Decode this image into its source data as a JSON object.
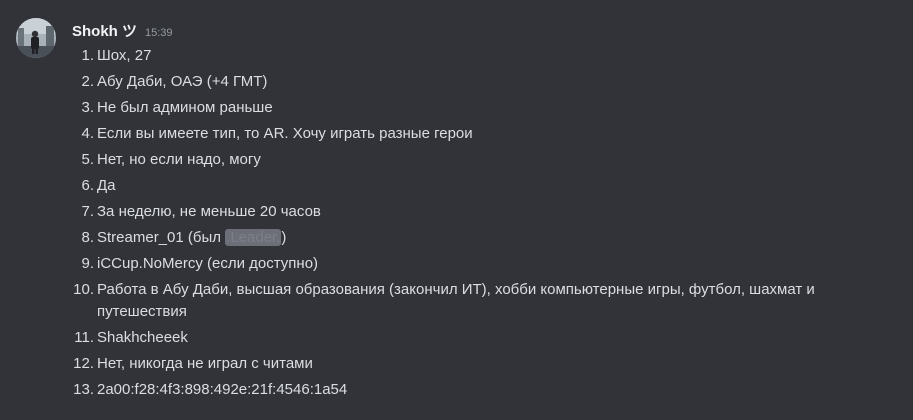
{
  "author": {
    "name": "Shokh ツ",
    "timestamp": "15:39"
  },
  "answers": [
    {
      "num": "1.",
      "text": "Шох, 27"
    },
    {
      "num": "2.",
      "text": "Абу Даби, ОАЭ (+4 ГМТ)"
    },
    {
      "num": "3.",
      "text": "Не был админом раньше"
    },
    {
      "num": "4.",
      "text": "Если вы имеете тип, то AR. Хочу играть разные герои"
    },
    {
      "num": "5.",
      "text": "Нет, но если надо, могу"
    },
    {
      "num": "6.",
      "text": "Да"
    },
    {
      "num": "7.",
      "text": "За неделю, не меньше 20 часов"
    },
    {
      "num": "8.",
      "prefix": "Streamer_01 (был ",
      "spoiler": ".Leader.",
      "suffix": ")"
    },
    {
      "num": "9.",
      "text": "iCCup.NoMercy (если доступно)"
    },
    {
      "num": "10.",
      "text": "Работа в Абу Даби, высшая образования (закончил ИТ), хобби компьютерные игры, футбол, шахмат и путешествия"
    },
    {
      "num": "11.",
      "text": "Shakhcheeek"
    },
    {
      "num": "12.",
      "text": "Нет, никогда не играл с читами"
    },
    {
      "num": "13.",
      "text": "2a00:f28:4f3:898:492e:21f:4546:1a54"
    }
  ]
}
